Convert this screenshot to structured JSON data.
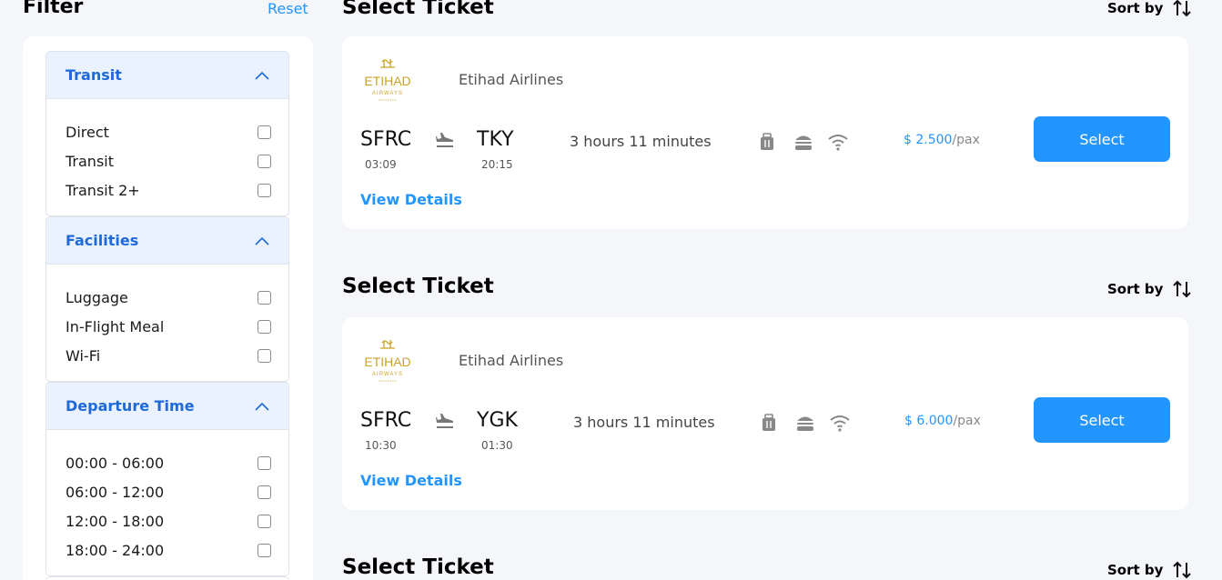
{
  "filter": {
    "title": "Filter",
    "reset_label": "Reset",
    "groups": [
      {
        "title": "Transit",
        "options": [
          "Direct",
          "Transit",
          "Transit 2+"
        ]
      },
      {
        "title": "Facilities",
        "options": [
          "Luggage",
          "In-Flight Meal",
          "Wi-Fi"
        ]
      },
      {
        "title": "Departure Time",
        "options": [
          "00:00 - 06:00",
          "06:00 - 12:00",
          "12:00 - 18:00",
          "18:00 - 24:00"
        ]
      }
    ]
  },
  "sections": [
    {
      "title": "Select Ticket",
      "sort_label": "Sort by"
    },
    {
      "title": "Select Ticket",
      "sort_label": "Sort by"
    },
    {
      "title": "Select Ticket",
      "sort_label": "Sort by"
    }
  ],
  "tickets": [
    {
      "airline": "Etihad Airlines",
      "from": "SFRC",
      "from_time": "03:09",
      "to": "TKY",
      "to_time": "20:15",
      "duration": "3 hours 11 minutes",
      "price": "$ 2.500",
      "price_unit": "/pax",
      "select_label": "Select",
      "details_label": "View Details"
    },
    {
      "airline": "Etihad Airlines",
      "from": "SFRC",
      "from_time": "10:30",
      "to": "YGK",
      "to_time": "01:30",
      "duration": "3 hours 11 minutes",
      "price": "$ 6.000",
      "price_unit": "/pax",
      "select_label": "Select",
      "details_label": "View Details"
    }
  ],
  "colors": {
    "accent": "#2395FF",
    "filter_head_bg": "#E9F2FE",
    "filter_head_text": "#2069D8",
    "logo_gold": "#C9A227",
    "page_bg": "#F5F6FA"
  },
  "icons": {
    "sort": "sort-arrows-icon",
    "chevron": "chevron-up-icon",
    "plane": "plane-icon",
    "luggage": "luggage-icon",
    "meal": "burger-icon",
    "wifi": "wifi-icon",
    "logo": "etihad-logo"
  }
}
